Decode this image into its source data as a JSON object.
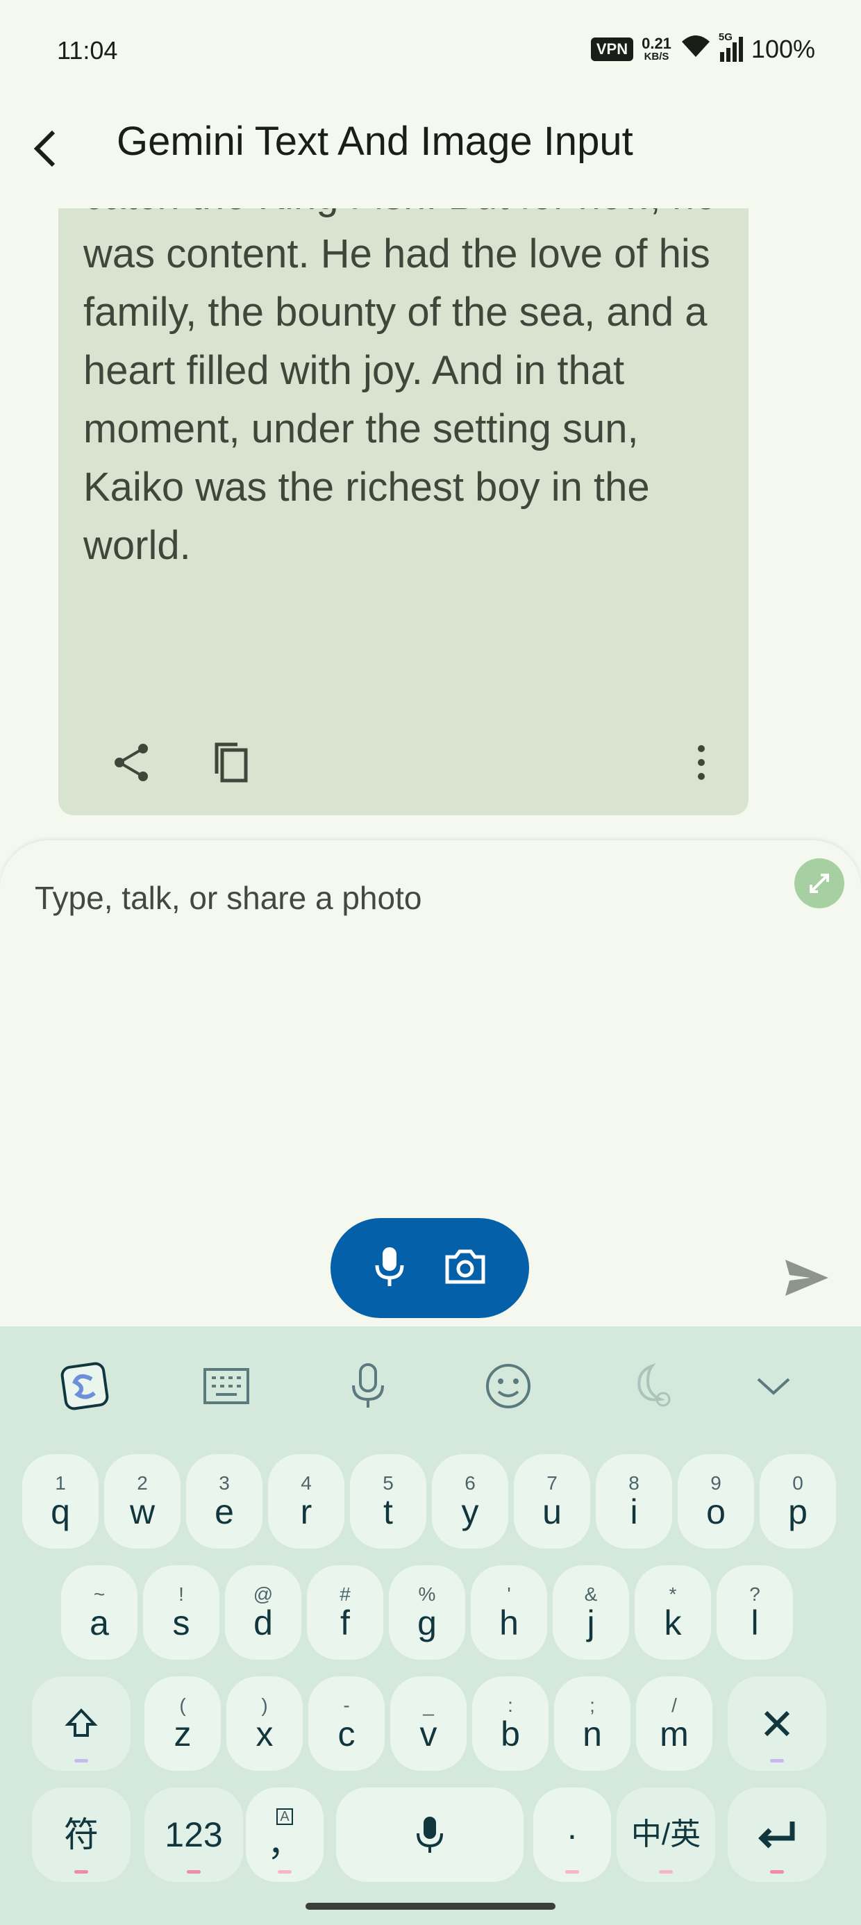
{
  "status_bar": {
    "time": "11:04",
    "vpn": "VPN",
    "speed_value": "0.21",
    "speed_unit": "KB/S",
    "network": "5G",
    "battery": "100%"
  },
  "app_bar": {
    "title": "Gemini Text And Image Input",
    "back_icon": "arrow-back-icon"
  },
  "message": {
    "text": "catch the King Fish. But for now, he was content. He had the love of his family, the bounty of the sea, and a heart filled with joy. And in that moment, under the setting sun, Kaiko was the richest boy in the world.",
    "actions": [
      "share-icon",
      "copy-icon",
      "more-vert-icon"
    ]
  },
  "input": {
    "placeholder": "Type, talk, or share a photo",
    "icons": [
      "expand-icon",
      "mic-icon",
      "camera-icon",
      "send-icon"
    ]
  },
  "keyboard": {
    "toolbar": [
      "sogou-logo-icon",
      "keyboard-icon",
      "voice-icon",
      "emoji-icon",
      "dark-mode-icon",
      "collapse-icon"
    ],
    "row1": [
      {
        "hint": "1",
        "key": "q"
      },
      {
        "hint": "2",
        "key": "w"
      },
      {
        "hint": "3",
        "key": "e"
      },
      {
        "hint": "4",
        "key": "r"
      },
      {
        "hint": "5",
        "key": "t"
      },
      {
        "hint": "6",
        "key": "y"
      },
      {
        "hint": "7",
        "key": "u"
      },
      {
        "hint": "8",
        "key": "i"
      },
      {
        "hint": "9",
        "key": "o"
      },
      {
        "hint": "0",
        "key": "p"
      }
    ],
    "row2": [
      {
        "hint": "~",
        "key": "a"
      },
      {
        "hint": "!",
        "key": "s"
      },
      {
        "hint": "@",
        "key": "d"
      },
      {
        "hint": "#",
        "key": "f"
      },
      {
        "hint": "%",
        "key": "g"
      },
      {
        "hint": "'",
        "key": "h"
      },
      {
        "hint": "&",
        "key": "j"
      },
      {
        "hint": "*",
        "key": "k"
      },
      {
        "hint": "?",
        "key": "l"
      }
    ],
    "row3": [
      {
        "hint": "(",
        "key": "z"
      },
      {
        "hint": ")",
        "key": "x"
      },
      {
        "hint": "-",
        "key": "c"
      },
      {
        "hint": "_",
        "key": "v"
      },
      {
        "hint": ":",
        "key": "b"
      },
      {
        "hint": ";",
        "key": "n"
      },
      {
        "hint": "/",
        "key": "m"
      }
    ],
    "row4": {
      "symbols": "符",
      "numbers": "123",
      "comma": "，",
      "comma_hint": "A",
      "period": "·",
      "lang": "中/英"
    }
  }
}
